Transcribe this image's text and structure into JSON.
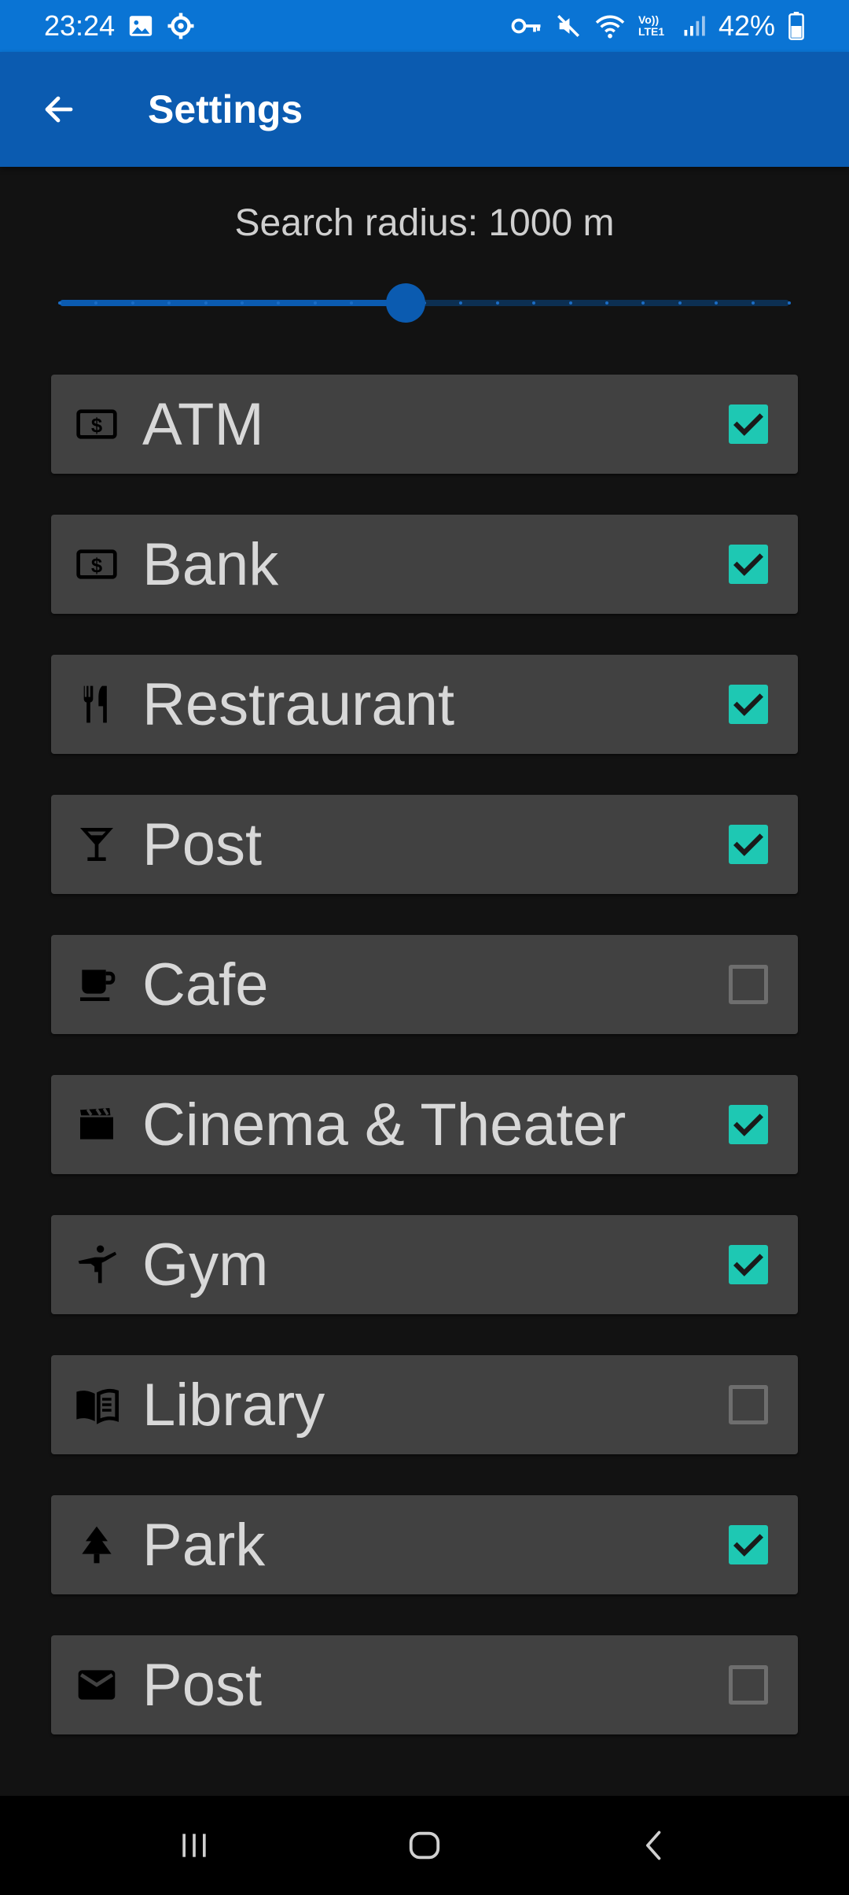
{
  "status_bar": {
    "time": "23:24",
    "battery_percent": "42%",
    "left_icons": [
      "image-icon",
      "gear-icon"
    ],
    "right_icons": [
      "vpn-key-icon",
      "mute-icon",
      "wifi-icon",
      "volte-icon",
      "signal-icon",
      "battery-icon"
    ],
    "volte_text": "Vo)) LTE1"
  },
  "app_bar": {
    "title": "Settings",
    "back_icon": "arrow-left-icon"
  },
  "radius": {
    "label": "Search radius: 1000 m",
    "slider_fraction": 0.474,
    "tick_count": 20
  },
  "categories": [
    {
      "label": "ATM",
      "icon": "money-icon",
      "checked": true
    },
    {
      "label": "Bank",
      "icon": "money-icon",
      "checked": true
    },
    {
      "label": "Restraurant",
      "icon": "restaurant-icon",
      "checked": true
    },
    {
      "label": "Post",
      "icon": "cocktail-icon",
      "checked": true
    },
    {
      "label": "Cafe",
      "icon": "coffee-icon",
      "checked": false
    },
    {
      "label": "Cinema & Theater",
      "icon": "clapperboard-icon",
      "checked": true
    },
    {
      "label": "Gym",
      "icon": "martial-arts-icon",
      "checked": true
    },
    {
      "label": "Library",
      "icon": "book-icon",
      "checked": false
    },
    {
      "label": "Park",
      "icon": "tree-icon",
      "checked": true
    },
    {
      "label": "Post",
      "icon": "mail-icon",
      "checked": false
    }
  ],
  "nav_bar": {
    "buttons": [
      "recent-apps-icon",
      "home-icon",
      "back-icon"
    ]
  },
  "colors": {
    "status_bar": "#0a74d4",
    "app_bar": "#0b5bb0",
    "background": "#121212",
    "card": "#414141",
    "checkbox_checked": "#1ec8b3"
  }
}
